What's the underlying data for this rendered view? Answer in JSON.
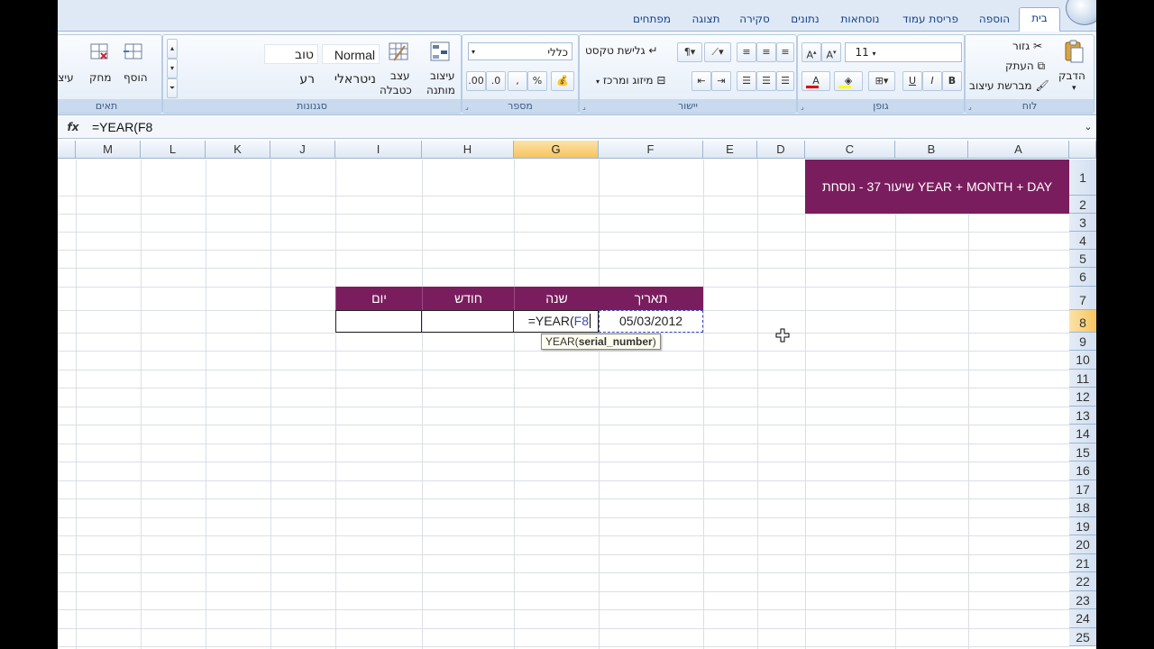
{
  "tabs": [
    "בית",
    "הוספה",
    "פריסת עמוד",
    "נוסחאות",
    "נתונים",
    "סקירה",
    "תצוגה",
    "מפתחים"
  ],
  "ribbon": {
    "clipboard": {
      "title": "לוח",
      "paste": "הדבק",
      "cut": "גזור",
      "copy": "העתק",
      "format_painter": "מברשת עיצוב"
    },
    "font": {
      "title": "גופן",
      "size": "11"
    },
    "alignment": {
      "title": "יישור",
      "wrap_text": "גלישת טקסט",
      "merge_center": "מיזוג ומרכז"
    },
    "number": {
      "title": "מספר",
      "format": "כללי"
    },
    "styles": {
      "title": "סגנונות",
      "conditional_1": "עיצוב",
      "conditional_2": "מותנה",
      "as_table_1": "עצב",
      "as_table_2": "כטבלה",
      "normal": "Normal",
      "good": "טוב",
      "neutral": "ניטראלי",
      "bad": "רע"
    },
    "cells": {
      "title": "תאים",
      "insert": "הוסף",
      "delete": "מחק",
      "format": "עיצו"
    }
  },
  "formula_bar": {
    "fx": "fx",
    "formula": "=YEAR(F8"
  },
  "columns": [
    "M",
    "L",
    "K",
    "J",
    "I",
    "H",
    "G",
    "F",
    "E",
    "D",
    "C",
    "B",
    "A"
  ],
  "rows": [
    "1",
    "2",
    "3",
    "4",
    "5",
    "6",
    "7",
    "8",
    "9",
    "10",
    "11",
    "12",
    "13",
    "14",
    "15",
    "16",
    "17",
    "18",
    "19",
    "20",
    "21",
    "22",
    "23",
    "24",
    "25"
  ],
  "sheet": {
    "title_banner": "שיעור 37 - נוסחת YEAR + MONTH + DAY",
    "headers": {
      "date": "תאריך",
      "year": "שנה",
      "month": "חודש",
      "day": "יום"
    },
    "date_value": "05/03/2012",
    "edit_prefix": "=YEAR(",
    "edit_ref": "F8",
    "tooltip_fn": "YEAR(",
    "tooltip_arg": "serial_number",
    "tooltip_end": ")"
  },
  "colors": {
    "banner": "#7a1d5e",
    "selected_header": "#f7c45f",
    "ribbon_title": "#c9d9ee"
  }
}
